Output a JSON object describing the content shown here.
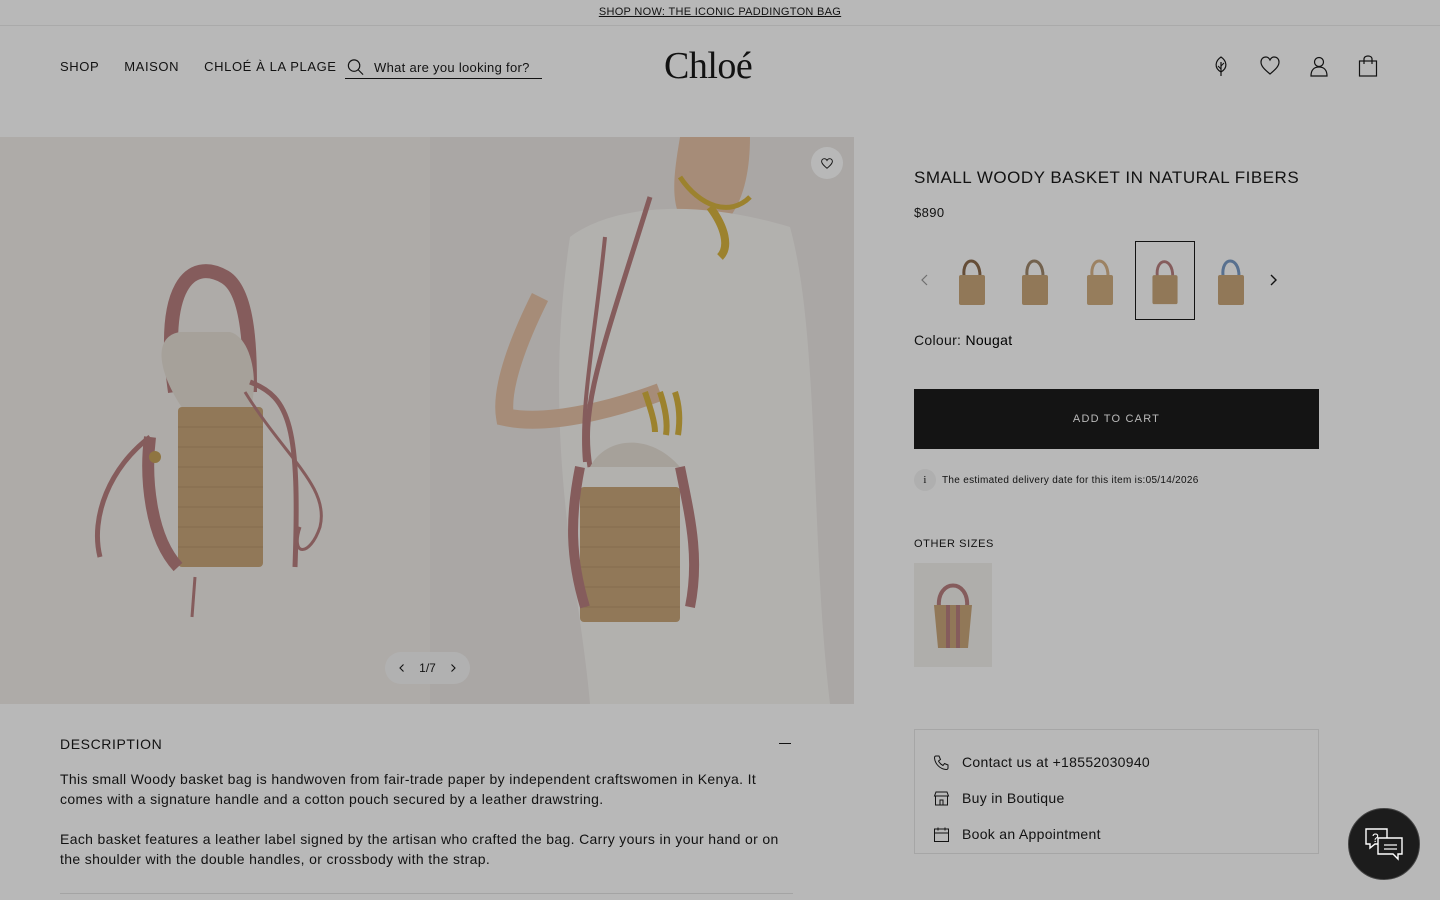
{
  "promo": {
    "text": "SHOP NOW: THE ICONIC PADDINGTON BAG"
  },
  "header": {
    "nav": [
      "SHOP",
      "MAISON",
      "CHLOÉ À LA PLAGE"
    ],
    "search_placeholder": "What are you looking for?",
    "logo": "Chloé",
    "icons": [
      "sustainability-icon",
      "wishlist-icon",
      "account-icon",
      "bag-icon"
    ]
  },
  "gallery": {
    "counter": "1/7"
  },
  "product": {
    "title": "SMALL WOODY BASKET IN NATURAL FIBERS",
    "price": "$890",
    "colour_label": "Colour:",
    "colour_value": "Nougat",
    "add_to_cart": "ADD TO CART",
    "delivery_text": "The estimated delivery date for this item is:05/14/2026",
    "info_glyph": "i",
    "other_sizes": "OTHER SIZES"
  },
  "description": {
    "title": "DESCRIPTION",
    "paragraphs": [
      "This small Woody basket bag is handwoven from fair-trade paper by independent craftswomen in Kenya. It comes with a signature handle and a cotton pouch secured by a leather drawstring.",
      "Each basket features a leather label signed by the artisan who crafted the bag. Carry yours in your hand or on the shoulder with the double handles, or crossbody with the strap."
    ]
  },
  "contact": {
    "items": [
      "Contact us at +18552030940",
      "Buy in Boutique",
      "Book an Appointment"
    ]
  },
  "colors": {
    "basket": "#c9a77a",
    "strap_pink": "#b98080",
    "strap_blue": "#7a9cc6",
    "button": "#1c1c1c"
  }
}
